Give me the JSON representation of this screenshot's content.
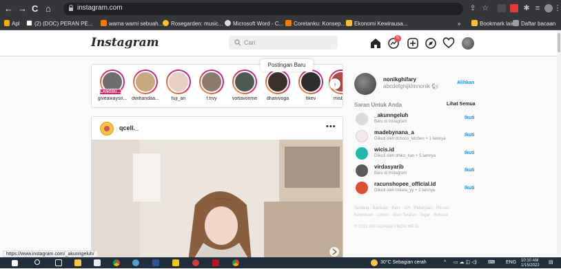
{
  "browser": {
    "url": "instagram.com",
    "nav_back": "←",
    "nav_forward": "→",
    "nav_reload": "C",
    "nav_home": "⌂"
  },
  "bookmarks": {
    "apps": "Apl",
    "items": [
      "(2) (DOC) PERAN PE...",
      "warna warni sebuah...",
      "Rosegarden: music...",
      "Microsoft Word - C...",
      "Coretanku: Konsep...",
      "Ekonomi Kewirausa..."
    ],
    "more": "»",
    "other": "Bookmark lain",
    "reading_list": "Daftar bacaan"
  },
  "ig_header": {
    "logo": "Instagram",
    "search_placeholder": "Cari",
    "notification_count": "5"
  },
  "stories": {
    "live_badge": "LANGSU...",
    "tooltip": "Postingan Baru",
    "items": [
      {
        "username": "giveawaysri..."
      },
      {
        "username": "dwihandaa..."
      },
      {
        "username": "fuji_an"
      },
      {
        "username": "f.trvy"
      },
      {
        "username": "vottavorime"
      },
      {
        "username": "dhanivoga"
      },
      {
        "username": "fikev"
      },
      {
        "username": "misbak"
      }
    ]
  },
  "post": {
    "username": "qcell._",
    "more": "•••"
  },
  "sidebar": {
    "profile_username": "nonikghifary",
    "profile_name": "abcdefghijklmnonik 🐿",
    "switch_label": "Alihkan",
    "suggestions_title": "Saran Untuk Anda",
    "see_all": "Lihat Semua",
    "suggestions": [
      {
        "username": "_akunngeluh",
        "reason": "Baru di Instagram",
        "action": "Ikuti"
      },
      {
        "username": "madebynana_a",
        "reason": "Diikuti oleh dchoco_kitchen + 1 lainnya",
        "action": "Ikuti"
      },
      {
        "username": "wicis.id",
        "reason": "Diikuti oleh dhiko_tian + 5 lainnya",
        "action": "Ikuti"
      },
      {
        "username": "virdasyarib",
        "reason": "Baru di Instagram",
        "action": "Ikuti"
      },
      {
        "username": "racunshopee_official.id",
        "reason": "Diikuti oleh tridara_yy + 2 lainnya",
        "action": "Ikuti"
      }
    ],
    "footer_line1": "Tentang · Bantuan · Pers · API · Pekerjaan · Privasi ·",
    "footer_line2": "Ketentuan · Lokasi · Akun Teratas · Tagar · Bahasa",
    "copyright": "© 2022 INSTAGRAM FROM META"
  },
  "status_url": "https://www.instagram.com/_akunngeluh/",
  "taskbar": {
    "weather": "30°C  Sebagian cerah",
    "language": "ENG",
    "time": "10:10 AM",
    "date": "1/15/2022"
  }
}
